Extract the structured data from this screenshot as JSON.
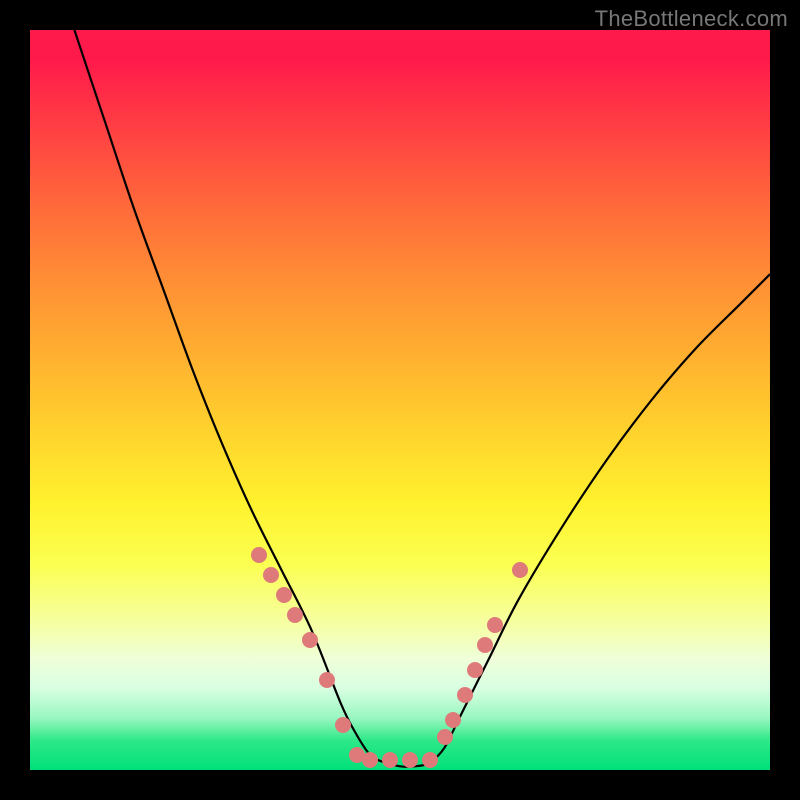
{
  "watermark": "TheBottleneck.com",
  "colors": {
    "frame": "#000000",
    "curve": "#000000",
    "dot": "#df7a7a"
  },
  "chart_data": {
    "type": "line",
    "title": "",
    "xlabel": "",
    "ylabel": "",
    "xlim": [
      0,
      100
    ],
    "ylim": [
      0,
      100
    ],
    "series": [
      {
        "name": "curve",
        "x": [
          6,
          10,
          14,
          18,
          22,
          26,
          30,
          34,
          38,
          42,
          44,
          46,
          48,
          50,
          52,
          54,
          56,
          58,
          62,
          66,
          72,
          78,
          84,
          90,
          96,
          100
        ],
        "y": [
          100,
          88,
          76,
          65,
          54,
          44,
          35,
          27,
          19,
          9,
          5,
          2,
          1,
          0.5,
          0.5,
          1,
          3,
          7,
          15,
          23,
          33,
          42,
          50,
          57,
          63,
          67
        ]
      }
    ],
    "dots": {
      "name": "markers",
      "x": [
        31.0,
        32.5,
        34.3,
        35.8,
        37.8,
        40.2,
        42.3,
        44.2,
        45.9,
        48.6,
        51.4,
        54.1,
        56.1,
        57.2,
        58.8,
        60.1,
        61.5,
        62.8,
        66.2
      ],
      "y": [
        29.1,
        26.4,
        23.6,
        21.0,
        17.6,
        12.2,
        6.1,
        2.0,
        1.4,
        1.4,
        1.4,
        1.4,
        4.4,
        6.8,
        10.1,
        13.5,
        16.9,
        19.6,
        27.0
      ]
    }
  }
}
